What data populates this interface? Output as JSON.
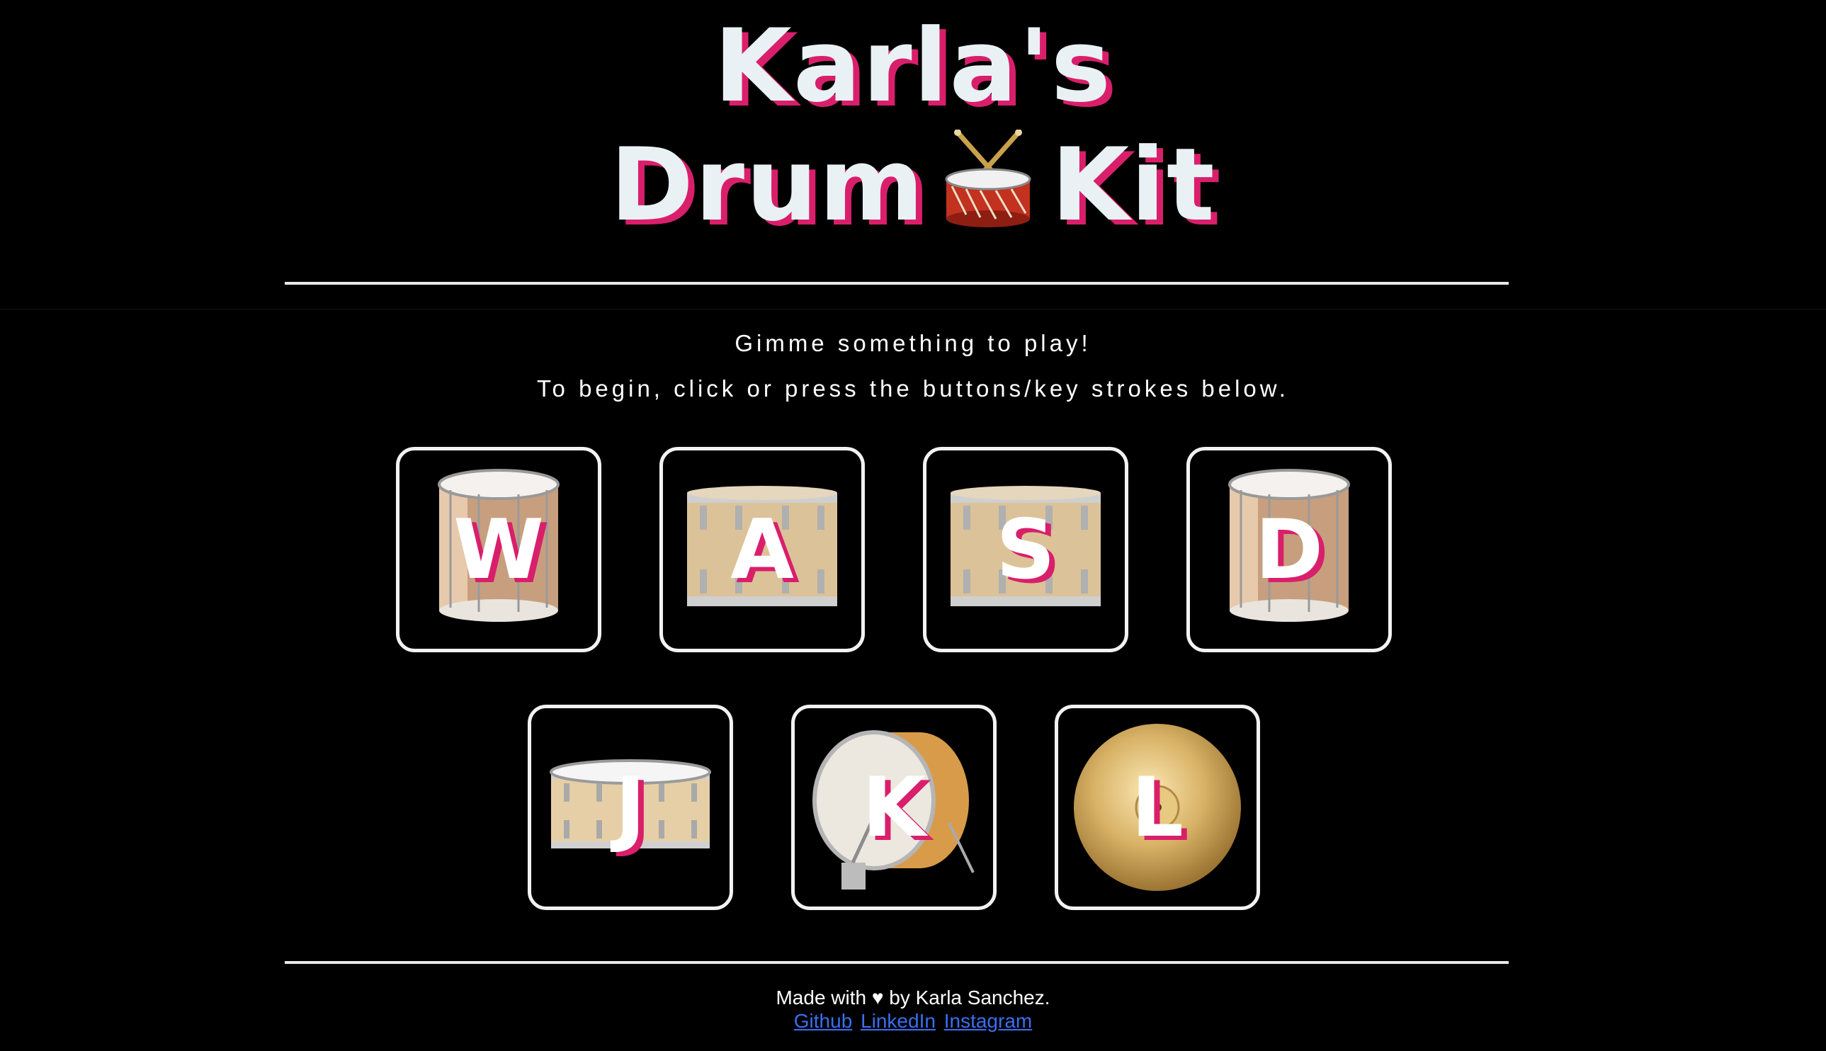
{
  "header": {
    "title_line1": "Karla's",
    "title_line2_left": "Drum",
    "title_line2_right": "Kit",
    "title_icon": "drum-icon"
  },
  "intro": {
    "line1": "Gimme something to play!",
    "line2": "To begin, click or press the buttons/key strokes below."
  },
  "drums": [
    {
      "key": "W",
      "icon": "tom-drum-icon"
    },
    {
      "key": "A",
      "icon": "tom-drum-icon"
    },
    {
      "key": "S",
      "icon": "tom-drum-icon"
    },
    {
      "key": "D",
      "icon": "tom-drum-icon"
    },
    {
      "key": "J",
      "icon": "snare-drum-icon"
    },
    {
      "key": "K",
      "icon": "bass-drum-icon"
    },
    {
      "key": "L",
      "icon": "cymbal-icon"
    }
  ],
  "footer": {
    "made_with_prefix": "Made with",
    "heart": "♥",
    "made_with_suffix": "by Karla Sanchez.",
    "links": [
      "Github",
      "LinkedIn",
      "Instagram"
    ]
  },
  "colors": {
    "background": "#000000",
    "accent": "#d91f6b",
    "title_text": "#e9f1f4",
    "link": "#3b6ff0"
  }
}
